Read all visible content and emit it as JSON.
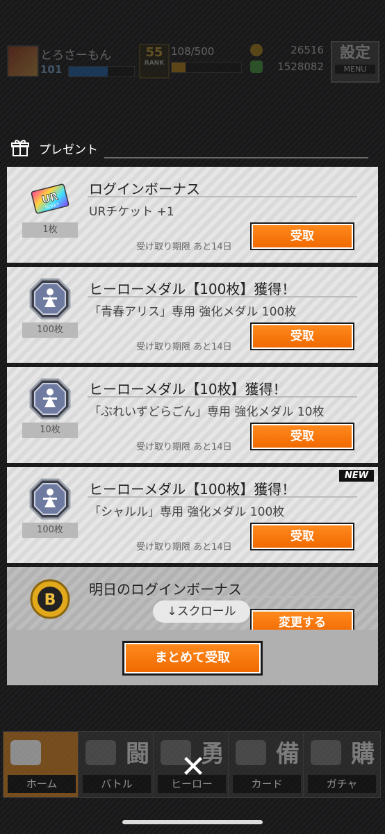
{
  "status": {
    "player_name": "とろさーもん",
    "level": "101",
    "rank_label": "RANK",
    "rank_value": "55",
    "exp": "108/500",
    "coins": "26516",
    "gold": "1528082",
    "menu_big": "設定",
    "menu_small": "MENU"
  },
  "header": {
    "title": "プレゼント"
  },
  "presents": [
    {
      "title": "ログインボーナス",
      "desc": "URチケット +1",
      "qty": "1枚",
      "expire": "受け取り期限 あと14日",
      "button": "受取",
      "icon": "ur-ticket-icon",
      "new": ""
    },
    {
      "title": "ヒーローメダル【100枚】獲得！",
      "desc": "「青春アリス」専用 強化メダル 100枚",
      "qty": "100枚",
      "expire": "受け取り期限 あと14日",
      "button": "受取",
      "icon": "hero-medal-icon",
      "new": ""
    },
    {
      "title": "ヒーローメダル【10枚】獲得！",
      "desc": "「ぶれいずどらごん」専用 強化メダル 10枚",
      "qty": "10枚",
      "expire": "受け取り期限 あと14日",
      "button": "受取",
      "icon": "hero-medal-icon",
      "new": ""
    },
    {
      "title": "ヒーローメダル【100枚】獲得！",
      "desc": "「シャルル」専用 強化メダル 100枚",
      "qty": "100枚",
      "expire": "受け取り期限 あと14日",
      "button": "受取",
      "icon": "hero-medal-icon",
      "new": "NEW"
    }
  ],
  "tomorrow": {
    "title": "明日のログインボーナス",
    "button": "変更する",
    "icon": "b-coin-icon"
  },
  "scroll_hint": "↓スクロール",
  "receive_all": "まとめて受取",
  "nav": [
    {
      "label": "ホーム",
      "kanji": ""
    },
    {
      "label": "バトル",
      "kanji": "闘"
    },
    {
      "label": "ヒーロー",
      "kanji": "勇"
    },
    {
      "label": "カード",
      "kanji": "備"
    },
    {
      "label": "ガチャ",
      "kanji": "購"
    }
  ],
  "close_icon": "✕"
}
